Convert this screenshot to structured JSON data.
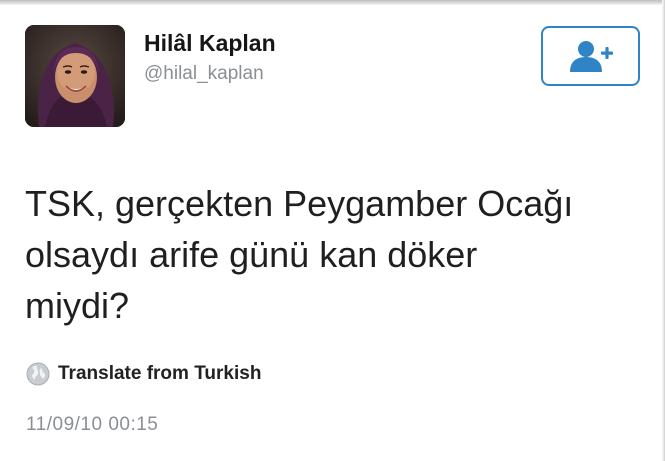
{
  "tweet": {
    "author": {
      "name": "Hilâl Kaplan",
      "handle": "@hilal_kaplan"
    },
    "text_lines": [
      "TSK, gerçekten Peygamber Ocağı",
      "olsaydı arife günü kan döker",
      "miydi?"
    ],
    "translate_label": "Translate from Turkish",
    "timestamp": "11/09/10 00:15"
  },
  "icons": {
    "follow": "add-user-icon",
    "translate": "globe-icon",
    "avatar": "profile-photo"
  },
  "colors": {
    "accent": "#2f84c6",
    "muted_text": "#8b8f94",
    "text": "#1f1f1f"
  }
}
